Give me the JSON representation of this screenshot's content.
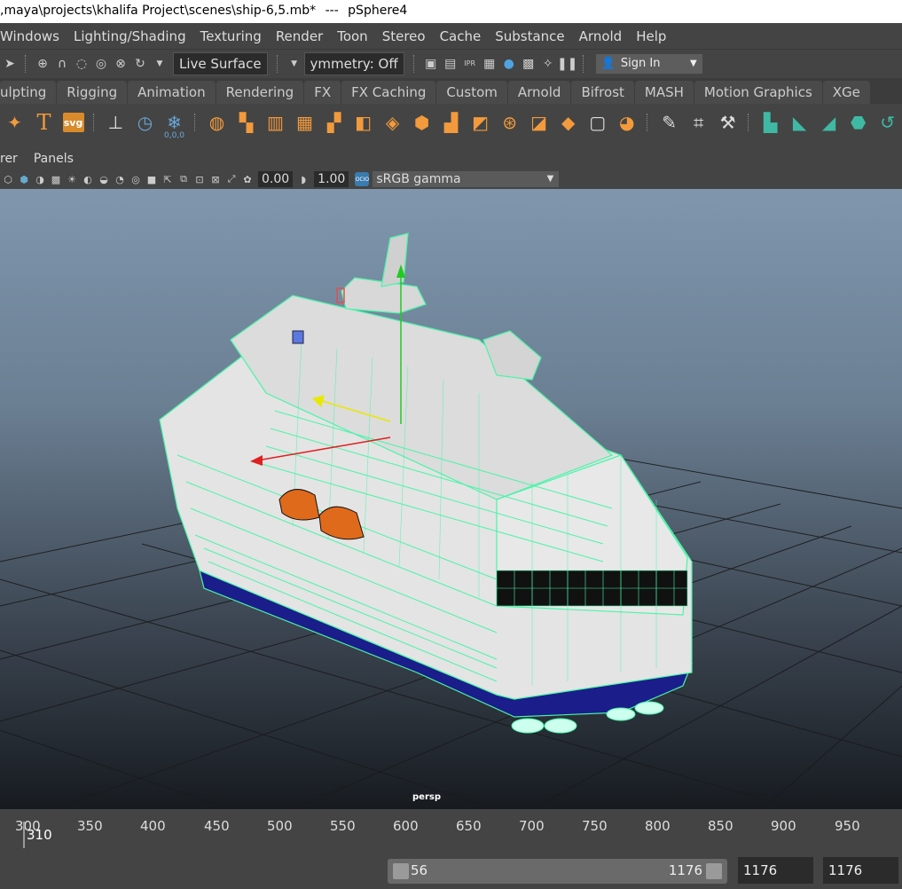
{
  "titlebar": {
    "path": ",maya\\projects\\khalifa Project\\scenes\\ship-6,5.mb*",
    "separator": "---",
    "object": "pSphere4"
  },
  "menu": [
    "Windows",
    "Lighting/Shading",
    "Texturing",
    "Render",
    "Toon",
    "Stereo",
    "Cache",
    "Substance",
    "Arnold",
    "Help"
  ],
  "statusline": {
    "live_surface": "Live Surface",
    "symmetry": "ymmetry: Off",
    "sign_in": "Sign In"
  },
  "shelf_tabs": [
    "ulpting",
    "Rigging",
    "Animation",
    "Rendering",
    "FX",
    "FX Caching",
    "Custom",
    "Arnold",
    "Bifrost",
    "MASH",
    "Motion Graphics",
    "XGe"
  ],
  "shelf_icons": {
    "text_tool": "T",
    "svg_tool": "svg",
    "coords_label": "0,0,0"
  },
  "panel_menu": [
    "rer",
    "Panels"
  ],
  "panel_toolbar": {
    "exposure": "0.00",
    "gamma": "1.00",
    "ocio_badge": "OCIO",
    "color_space": "sRGB gamma"
  },
  "viewport": {
    "camera": "persp"
  },
  "timeline": {
    "ticks": [
      "300",
      "350",
      "400",
      "450",
      "500",
      "550",
      "600",
      "650",
      "700",
      "750",
      "800",
      "850",
      "900",
      "950"
    ],
    "current_frame": "310"
  },
  "range": {
    "start": "56",
    "end": "1176",
    "anim_end": "1176",
    "playback_end": "1176"
  },
  "colors": {
    "wire": "#48f5a8",
    "hull_blue": "#1a1d8a",
    "lifeboat": "#e06a1b",
    "shelf_orange": "#f29a3c"
  }
}
